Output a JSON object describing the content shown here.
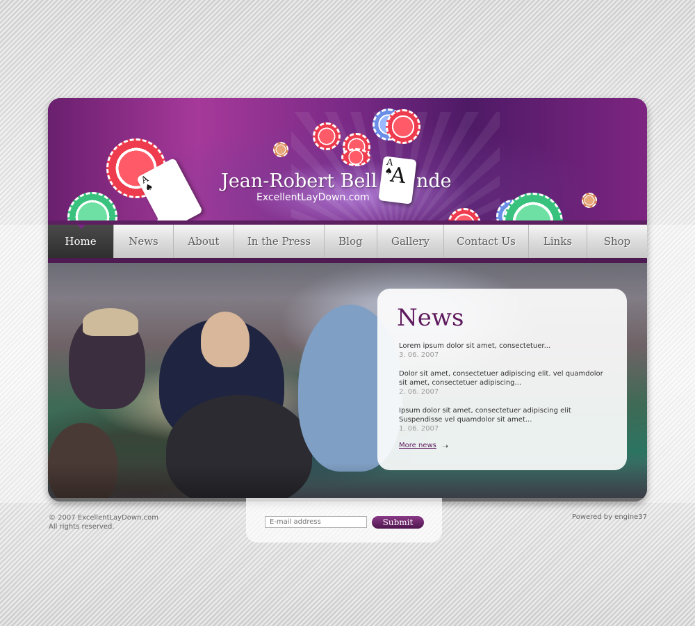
{
  "header": {
    "title_part1": "Jean-Robert Bell",
    "title_ace_letter": "A",
    "title_part2": "nde",
    "url": "ExcellentLayDown.com"
  },
  "nav": {
    "items": [
      {
        "label": "Home",
        "active": true
      },
      {
        "label": "News"
      },
      {
        "label": "About"
      },
      {
        "label": "In the Press"
      },
      {
        "label": "Blog"
      },
      {
        "label": "Gallery"
      },
      {
        "label": "Contact Us"
      },
      {
        "label": "Links"
      },
      {
        "label": "Shop"
      }
    ]
  },
  "news": {
    "heading": "News",
    "items": [
      {
        "text": "Lorem ipsum dolor sit amet, consectetuer...",
        "date": "3. 06. 2007"
      },
      {
        "text": "Dolor sit amet, consectetuer adipiscing elit. vel quamdolor sit amet, consectetuer adipiscing...",
        "date": "2. 06. 2007"
      },
      {
        "text": "Ipsum dolor sit amet, consectetuer adipiscing elit Suspendisse vel quamdolor sit amet...",
        "date": "1. 06. 2007"
      }
    ],
    "more_label": "More news"
  },
  "footer": {
    "copyright_line1": "© 2007  ExcellentLayDown.com",
    "copyright_line2": "All rights reserved.",
    "powered_by": "Powered by engine37",
    "email_placeholder": "E-mail address",
    "submit_label": "Submit"
  },
  "colors": {
    "brand_purple": "#5e1a5e",
    "header_magenta": "#a6399a",
    "nav_active": "#2e2e2e"
  },
  "icons": [
    "poker-chip-icon",
    "ace-of-spades-icon",
    "arrow-right-icon"
  ]
}
